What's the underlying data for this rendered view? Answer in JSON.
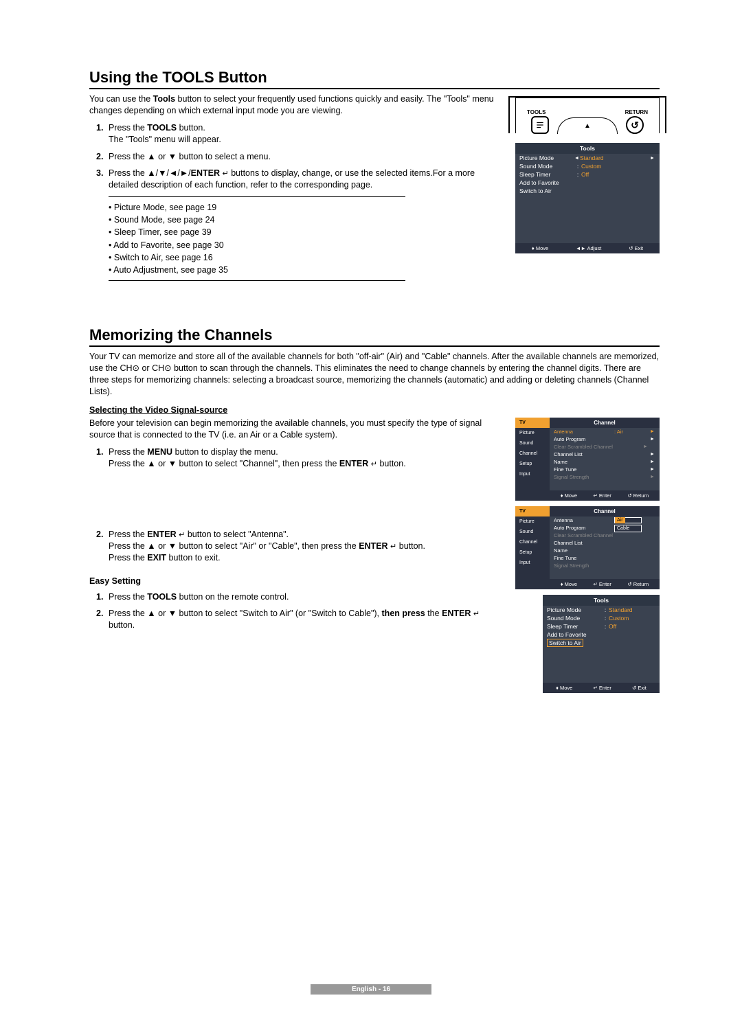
{
  "section1": {
    "title": "Using the TOOLS Button",
    "intro1": "You can use the ",
    "intro_bold": "Tools",
    "intro2": " button to select your frequently used functions quickly and easily. The \"Tools\" menu changes depending on which external input mode you are viewing.",
    "step1a": "Press the ",
    "step1b": "TOOLS",
    "step1c": " button.",
    "step1d": "The \"Tools\" menu will appear.",
    "step2": "Press the ▲ or ▼ button to select a menu.",
    "step3a": "Press the ▲/▼/◄/►/",
    "step3b": "ENTER",
    "step3c": " buttons to display, change, or use the selected items.For a more detailed description of each function, refer to the corresponding page.",
    "bullets": [
      "Picture Mode, see page 19",
      "Sound Mode, see page 24",
      "Sleep Timer, see page 39",
      "Add to Favorite, see page 30",
      "Switch to Air, see page 16",
      "Auto Adjustment, see page 35"
    ]
  },
  "remote": {
    "tools_label": "TOOLS",
    "return_label": "RETURN",
    "return_glyph": "↺",
    "up_glyph": "▲"
  },
  "tools_osd1": {
    "title": "Tools",
    "rows": [
      {
        "label": "Picture Mode",
        "value": "Standard",
        "arrows": true
      },
      {
        "label": "Sound Mode",
        "colon": ":",
        "value": "Custom"
      },
      {
        "label": "Sleep Timer",
        "colon": ":",
        "value": "Off"
      },
      {
        "label": "Add to Favorite"
      },
      {
        "label": "Switch to Air"
      }
    ],
    "footer": {
      "move": "Move",
      "adjust": "Adjust",
      "exit": "Exit"
    }
  },
  "section2": {
    "title": "Memorizing the Channels",
    "intro": "Your TV can memorize and store all of the available channels for both \"off-air\" (Air) and \"Cable\" channels. After the available channels are memorized, use the CH⊙ or CH⊙ button to scan through the channels. This eliminates the need to change channels by entering the channel digits. There are three steps for memorizing channels: selecting a broadcast source, memorizing the channels (automatic) and adding or deleting channels (Channel Lists).",
    "sub1": "Selecting the Video Signal-source",
    "sub1_text": "Before your television can begin memorizing the available channels, you must specify the type of signal source that is connected to the TV (i.e. an Air or a Cable system).",
    "s1_step1a": "Press the ",
    "s1_step1b": "MENU",
    "s1_step1c": " button to display the menu.",
    "s1_step1d": "Press the ▲ or ▼ button to select \"Channel\", then press the ",
    "s1_step1e": "ENTER",
    "s1_step1f": " button.",
    "s1_step2a": "Press the ",
    "s1_step2b": "ENTER",
    "s1_step2c": " button to select \"Antenna\".",
    "s1_step2d": "Press the ▲ or ▼ button to select \"Air\" or \"Cable\", then press the ",
    "s1_step2e": "ENTER",
    "s1_step2f": " button.",
    "s1_step2g": "Press the ",
    "s1_step2h": "EXIT",
    "s1_step2i": " button to exit.",
    "easy_title": "Easy Setting",
    "easy1a": "Press the ",
    "easy1b": "TOOLS",
    "easy1c": " button on the remote control.",
    "easy2a": "Press the ▲ or ▼ button to select \"Switch to Air\" (or \"Switch to Cable\"), ",
    "easy2b": "then press",
    "easy2c": " the ",
    "easy2d": "ENTER",
    "easy2e": " button."
  },
  "channel_osd1": {
    "title": "Channel",
    "nav": [
      "TV",
      "Picture",
      "Sound",
      "Channel",
      "Setup",
      "Input"
    ],
    "rows": [
      {
        "label": "Antenna",
        "value": ": Air",
        "chev": "►",
        "orange": true
      },
      {
        "label": "Auto Program",
        "chev": "►"
      },
      {
        "label": "Clear Scrambled Channel",
        "chev": "►",
        "dim": true,
        "orange": true
      },
      {
        "label": "Channel List",
        "chev": "►"
      },
      {
        "label": "Name",
        "chev": "►"
      },
      {
        "label": "Fine Tune",
        "chev": "►"
      },
      {
        "label": "Signal Strength",
        "chev": "►",
        "dim": true
      }
    ],
    "footer": {
      "move": "Move",
      "enter": "Enter",
      "return": "Return"
    }
  },
  "channel_osd2": {
    "title": "Channel",
    "nav": [
      "TV",
      "Picture",
      "Sound",
      "Channel",
      "Setup",
      "Input"
    ],
    "rows": [
      {
        "label": "Antenna",
        "dropdown": [
          "Air",
          "Cable"
        ],
        "sel": "Air"
      },
      {
        "label": "Auto Program"
      },
      {
        "label": "Clear Scrambled Channel",
        "dim": true,
        "orange": true
      },
      {
        "label": "Channel List"
      },
      {
        "label": "Name"
      },
      {
        "label": "Fine Tune"
      },
      {
        "label": "Signal Strength",
        "dim": true
      }
    ],
    "footer": {
      "move": "Move",
      "enter": "Enter",
      "return": "Return"
    }
  },
  "tools_osd2": {
    "title": "Tools",
    "rows": [
      {
        "label": "Picture Mode",
        "colon": ":",
        "value": "Standard"
      },
      {
        "label": "Sound Mode",
        "colon": ":",
        "value": "Custom"
      },
      {
        "label": "Sleep Timer",
        "colon": ":",
        "value": "Off"
      },
      {
        "label": "Add to Favorite"
      },
      {
        "label": "Switch to Air",
        "boxed": true
      }
    ],
    "footer": {
      "move": "Move",
      "enter": "Enter",
      "exit": "Exit"
    }
  },
  "footer": {
    "text": "English - 16"
  }
}
